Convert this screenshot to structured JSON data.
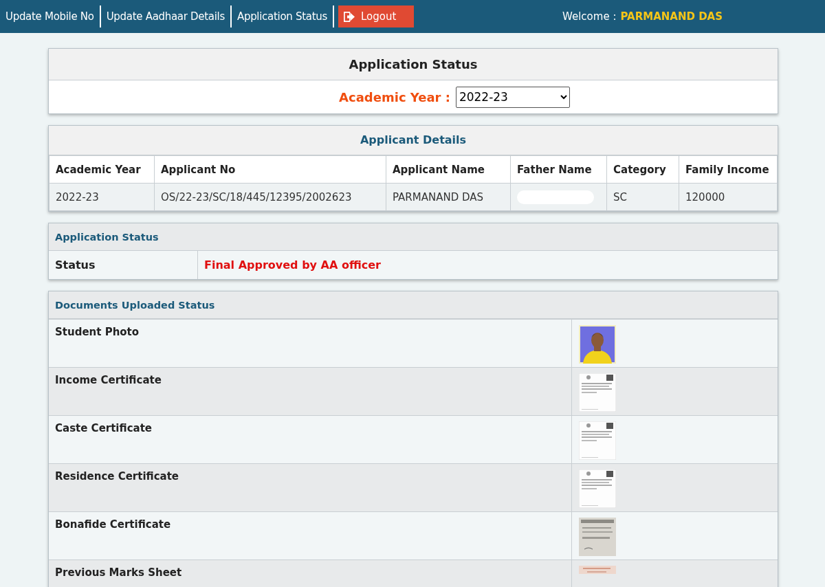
{
  "nav": {
    "links": [
      {
        "label": "Update Mobile No"
      },
      {
        "label": "Update Aadhaar Details"
      },
      {
        "label": "Application Status"
      }
    ],
    "logout": "Logout",
    "welcome_label": "Welcome :",
    "user_name": "PARMANAND DAS"
  },
  "status_card": {
    "title": "Application Status",
    "year_label": "Academic Year :",
    "year_value": "2022-23"
  },
  "applicant": {
    "title": "Applicant Details",
    "columns": [
      "Academic Year",
      "Applicant No",
      "Applicant Name",
      "Father Name",
      "Category",
      "Family Income"
    ],
    "rows": [
      [
        {
          "kind": "text",
          "text": "2022-23"
        },
        {
          "kind": "text",
          "text": "OS/22-23/SC/18/445/12395/2002623"
        },
        {
          "kind": "text",
          "text": "PARMANAND DAS"
        },
        {
          "kind": "redacted"
        },
        {
          "kind": "text",
          "text": "SC"
        },
        {
          "kind": "text",
          "text": "120000"
        }
      ]
    ]
  },
  "application_status": {
    "title": "Application Status",
    "label": "Status",
    "value": "Final Approved by AA officer"
  },
  "documents": {
    "title": "Documents Uploaded Status",
    "items": [
      {
        "name": "Student Photo"
      },
      {
        "name": "Income Certificate",
        "kind": "document"
      },
      {
        "name": "Caste Certificate",
        "kind": "document"
      },
      {
        "name": "Residence Certificate",
        "kind": "document"
      },
      {
        "name": "Bonafide Certificate",
        "kind": "scan"
      },
      {
        "name": "Previous Marks Sheet",
        "kind": "marksheet"
      }
    ]
  }
}
